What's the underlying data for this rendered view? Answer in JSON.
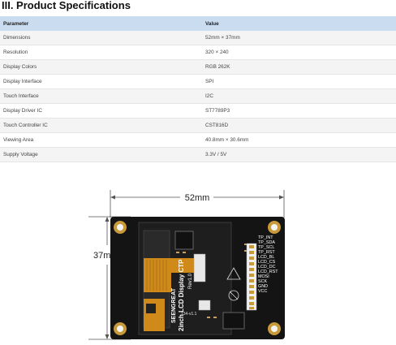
{
  "section_title": "III. Product Specifications",
  "table": {
    "headers": [
      "Parameter",
      "Value"
    ],
    "rows": [
      [
        "Dimensions",
        "52mm × 37mm"
      ],
      [
        "Resolution",
        "320 × 240"
      ],
      [
        "Display Colors",
        "RGB 262K"
      ],
      [
        "Display Interface",
        "SPI"
      ],
      [
        "Touch Interface",
        "I2C"
      ],
      [
        "Display Driver IC",
        "ST7789P3"
      ],
      [
        "Touch Controller IC",
        "CST816D"
      ],
      [
        "Viewing Area",
        "40.8mm × 30.6mm"
      ],
      [
        "Supply Voltage",
        "3.3V / 5V"
      ]
    ]
  },
  "board": {
    "width_label": "52mm",
    "height_label": "37mm",
    "brand": "SEENGREAT",
    "product_name": "2inch LCD Display CTP",
    "revision": "Rev1.0",
    "connector_marking": "134-v1.1",
    "pins": [
      "TP_INT",
      "TP_SDA",
      "TP_SCL",
      "TP_RST",
      "LCD_BL",
      "LCD_CS",
      "LCD_DC",
      "LCD_RST",
      "MOSI",
      "SCK",
      "GND",
      "VCC"
    ]
  }
}
